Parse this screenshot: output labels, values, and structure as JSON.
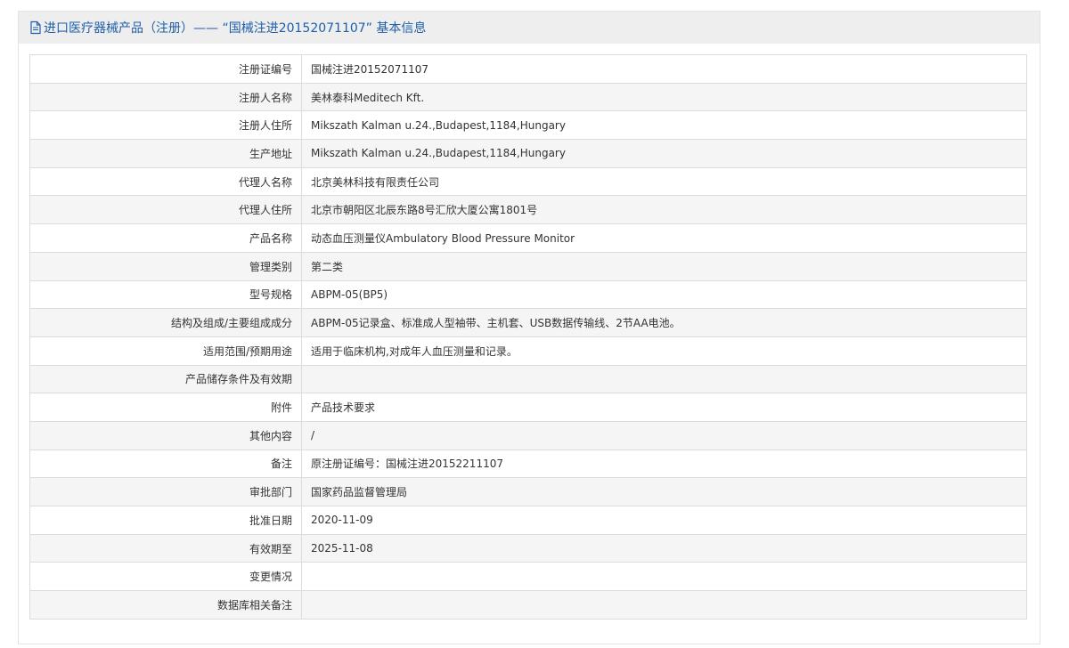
{
  "header": {
    "title": "进口医疗器械产品（注册）—— “国械注进20152071107” 基本信息",
    "icon": "document-icon",
    "title_color": "#1e5fa8"
  },
  "rows": [
    {
      "label": "注册证编号",
      "value": "国械注进20152071107"
    },
    {
      "label": "注册人名称",
      "value": "美林泰科Meditech Kft."
    },
    {
      "label": "注册人住所",
      "value": "Mikszath Kalman u.24.,Budapest,1184,Hungary"
    },
    {
      "label": "生产地址",
      "value": "Mikszath Kalman u.24.,Budapest,1184,Hungary"
    },
    {
      "label": "代理人名称",
      "value": "北京美林科技有限责任公司"
    },
    {
      "label": "代理人住所",
      "value": "北京市朝阳区北辰东路8号汇欣大厦公寓1801号"
    },
    {
      "label": "产品名称",
      "value": "动态血压测量仪Ambulatory Blood Pressure Monitor"
    },
    {
      "label": "管理类别",
      "value": "第二类"
    },
    {
      "label": "型号规格",
      "value": "ABPM-05(BP5)"
    },
    {
      "label": "结构及组成/主要组成成分",
      "value": "ABPM-05记录盒、标准成人型袖带、主机套、USB数据传输线、2节AA电池。"
    },
    {
      "label": "适用范围/预期用途",
      "value": "适用于临床机构,对成年人血压测量和记录。"
    },
    {
      "label": "产品储存条件及有效期",
      "value": ""
    },
    {
      "label": "附件",
      "value": "产品技术要求"
    },
    {
      "label": "其他内容",
      "value": "/"
    },
    {
      "label": "备注",
      "value": "原注册证编号：国械注进20152211107"
    },
    {
      "label": "审批部门",
      "value": "国家药品监督管理局"
    },
    {
      "label": "批准日期",
      "value": "2020-11-09"
    },
    {
      "label": "有效期至",
      "value": "2025-11-08"
    },
    {
      "label": "变更情况",
      "value": ""
    },
    {
      "label": "数据库相关备注",
      "value": ""
    }
  ]
}
